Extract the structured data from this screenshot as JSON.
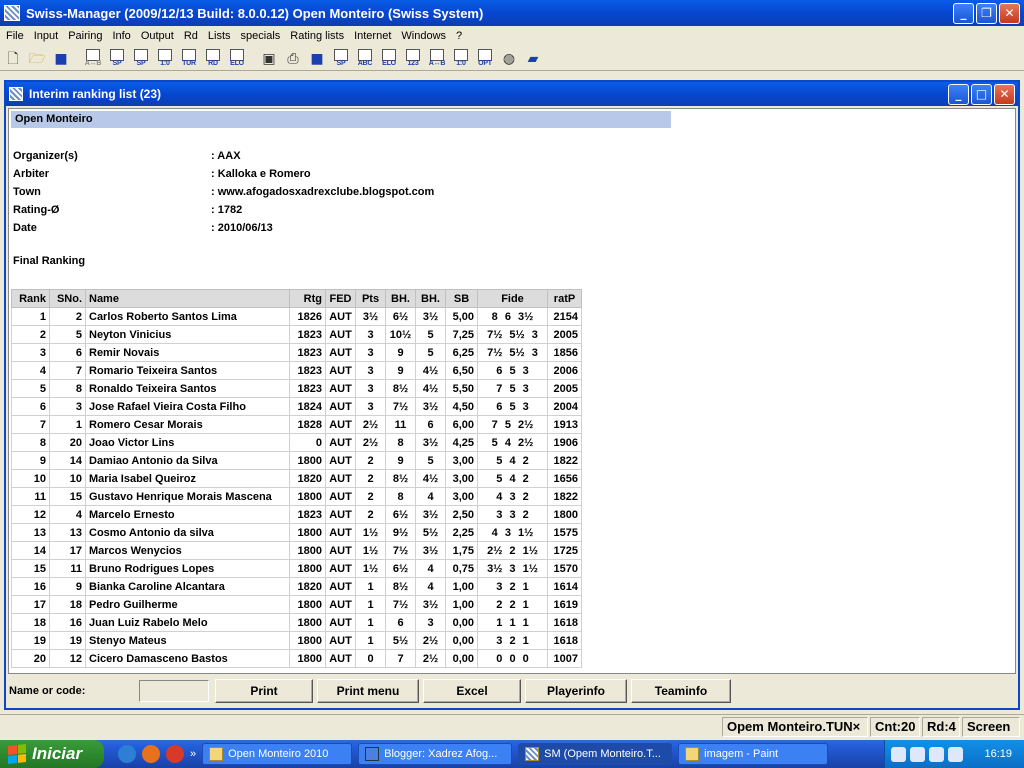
{
  "window": {
    "title": "Swiss-Manager (2009/12/13 Build: 8.0.0.12)  Open Monteiro    (Swiss System)"
  },
  "menu": [
    "File",
    "Input",
    "Pairing",
    "Info",
    "Output",
    "Rd",
    "Lists",
    "specials",
    "Rating lists",
    "Internet",
    "Windows",
    "?"
  ],
  "toolbar": {
    "icon_captions": [
      "new-file-icon",
      "open-folder-icon",
      "save-icon",
      "A↔B",
      "SP",
      "SP",
      "1:0",
      "TUR",
      "RD",
      "ELO",
      "window-icon",
      "print-icon",
      "save-icon",
      "SP",
      "ABC",
      "ELO",
      "123",
      "A↔B",
      "1:0",
      "OPT",
      "globe-icon",
      "book-icon"
    ]
  },
  "child": {
    "title": "Interim ranking list (23)",
    "tournament": "Open Monteiro",
    "info": [
      {
        "label": "Organizer(s)",
        "value": ": AAX"
      },
      {
        "label": "Arbiter",
        "value": ": Kalloka e Romero"
      },
      {
        "label": "Town",
        "value": ": www.afogadosxadrexclube.blogspot.com"
      },
      {
        "label": "Rating-Ø",
        "value": ": 1782"
      },
      {
        "label": "Date",
        "value": ": 2010/06/13"
      }
    ],
    "section_title": "Final Ranking",
    "columns": [
      "Rank",
      "SNo.",
      "Name",
      "Rtg",
      "FED",
      "Pts",
      "BH.",
      "BH.",
      "SB",
      "Fide",
      "ratP"
    ],
    "rows": [
      [
        "1",
        "2",
        "Carlos Roberto Santos Lima",
        "1826",
        "AUT",
        "3½",
        "6½",
        "3½",
        "5,00",
        "8   6   3½",
        "2154"
      ],
      [
        "2",
        "5",
        "Neyton Vinicius",
        "1823",
        "AUT",
        "3",
        "10½",
        "5",
        "7,25",
        "7½   5½   3",
        "2005"
      ],
      [
        "3",
        "6",
        "Remir Novais",
        "1823",
        "AUT",
        "3",
        "9",
        "5",
        "6,25",
        "7½   5½   3",
        "1856"
      ],
      [
        "4",
        "7",
        "Romario Teixeira Santos",
        "1823",
        "AUT",
        "3",
        "9",
        "4½",
        "6,50",
        "6   5   3",
        "2006"
      ],
      [
        "5",
        "8",
        "Ronaldo Teixeira Santos",
        "1823",
        "AUT",
        "3",
        "8½",
        "4½",
        "5,50",
        "7   5   3",
        "2005"
      ],
      [
        "6",
        "3",
        "Jose Rafael Vieira Costa Filho",
        "1824",
        "AUT",
        "3",
        "7½",
        "3½",
        "4,50",
        "6   5   3",
        "2004"
      ],
      [
        "7",
        "1",
        "Romero Cesar Morais",
        "1828",
        "AUT",
        "2½",
        "11",
        "6",
        "6,00",
        "7   5   2½",
        "1913"
      ],
      [
        "8",
        "20",
        "Joao Victor Lins",
        "0",
        "AUT",
        "2½",
        "8",
        "3½",
        "4,25",
        "5   4   2½",
        "1906"
      ],
      [
        "9",
        "14",
        "Damiao Antonio da Silva",
        "1800",
        "AUT",
        "2",
        "9",
        "5",
        "3,00",
        "5   4   2",
        "1822"
      ],
      [
        "10",
        "10",
        "Maria Isabel Queiroz",
        "1820",
        "AUT",
        "2",
        "8½",
        "4½",
        "3,00",
        "5   4   2",
        "1656"
      ],
      [
        "11",
        "15",
        "Gustavo Henrique Morais Mascena",
        "1800",
        "AUT",
        "2",
        "8",
        "4",
        "3,00",
        "4   3   2",
        "1822"
      ],
      [
        "12",
        "4",
        "Marcelo Ernesto",
        "1823",
        "AUT",
        "2",
        "6½",
        "3½",
        "2,50",
        "3   3   2",
        "1800"
      ],
      [
        "13",
        "13",
        "Cosmo Antonio da silva",
        "1800",
        "AUT",
        "1½",
        "9½",
        "5½",
        "2,25",
        "4   3   1½",
        "1575"
      ],
      [
        "14",
        "17",
        "Marcos Wenycios",
        "1800",
        "AUT",
        "1½",
        "7½",
        "3½",
        "1,75",
        "2½   2   1½",
        "1725"
      ],
      [
        "15",
        "11",
        "Bruno Rodrigues Lopes",
        "1800",
        "AUT",
        "1½",
        "6½",
        "4",
        "0,75",
        "3½   3   1½",
        "1570"
      ],
      [
        "16",
        "9",
        "Bianka Caroline Alcantara",
        "1820",
        "AUT",
        "1",
        "8½",
        "4",
        "1,00",
        "3   2   1",
        "1614"
      ],
      [
        "17",
        "18",
        "Pedro Guilherme",
        "1800",
        "AUT",
        "1",
        "7½",
        "3½",
        "1,00",
        "2   2   1",
        "1619"
      ],
      [
        "18",
        "16",
        "Juan Luiz Rabelo Melo",
        "1800",
        "AUT",
        "1",
        "6",
        "3",
        "0,00",
        "1   1   1",
        "1618"
      ],
      [
        "19",
        "19",
        "Stenyo Mateus",
        "1800",
        "AUT",
        "1",
        "5½",
        "2½",
        "0,00",
        "3   2   1",
        "1618"
      ],
      [
        "20",
        "12",
        "Cicero Damasceno Bastos",
        "1800",
        "AUT",
        "0",
        "7",
        "2½",
        "0,00",
        "0   0   0",
        "1007"
      ]
    ],
    "name_label": "Name or code:",
    "buttons": [
      "Print",
      "Print menu",
      "Excel",
      "Playerinfo",
      "Teaminfo"
    ]
  },
  "status": [
    "Opem Monteiro.TUN×",
    "Cnt:20",
    "Rd:4",
    "Screen"
  ],
  "taskbar": {
    "start": "Iniciar",
    "tasks": [
      "Open Monteiro 2010",
      "Blogger: Xadrez Afog...",
      "SM (Opem Monteiro.T...",
      "imagem - Paint"
    ],
    "clock": "16:19"
  }
}
